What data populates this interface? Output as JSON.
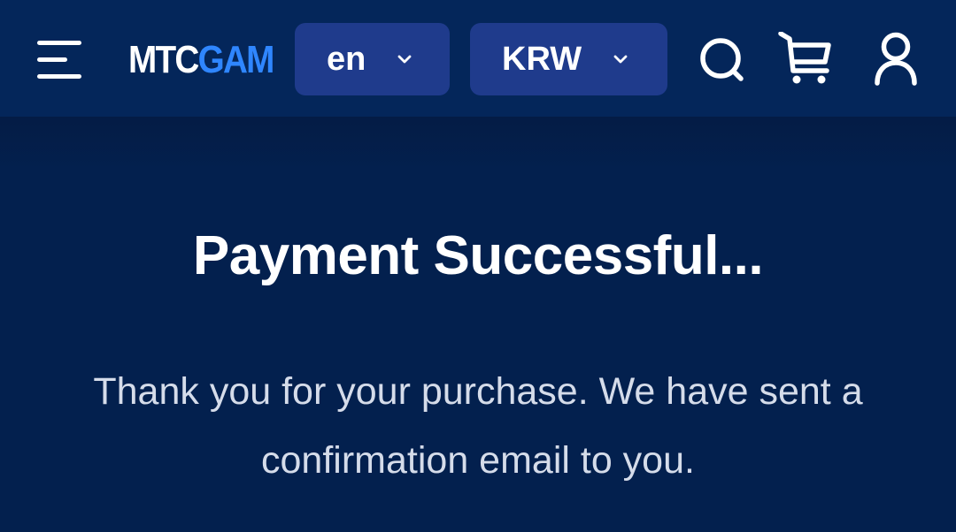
{
  "header": {
    "logo": {
      "part1": "MTC",
      "part2": "GAME"
    },
    "language": {
      "value": "en"
    },
    "currency": {
      "value": "KRW"
    },
    "icons": {
      "menu": "menu-icon",
      "search": "search-icon",
      "cart": "cart-icon",
      "account": "user-icon"
    }
  },
  "main": {
    "title": "Payment Successful...",
    "message": "Thank you for your purchase. We have sent a confirmation email to you."
  },
  "colors": {
    "background": "#03204e",
    "header_bg": "#04265a",
    "pill_bg": "#1f3b8c",
    "logo_accent": "#2f86ff",
    "text_primary": "#ffffff",
    "text_secondary": "#d5dcea"
  }
}
